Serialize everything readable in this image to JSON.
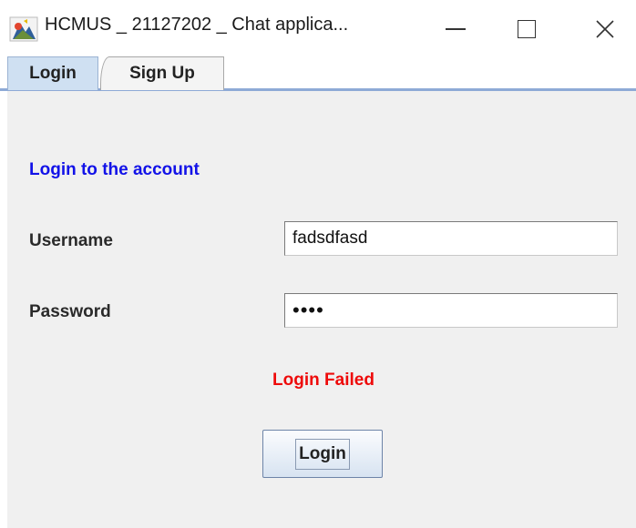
{
  "window": {
    "title": "HCMUS _ 21127202 _ Chat applica...",
    "icon": "java-app-icon",
    "controls": {
      "minimize_icon": "minimize-icon",
      "maximize_icon": "maximize-icon",
      "close_glyph": "✕"
    }
  },
  "tabs": [
    {
      "label": "Login",
      "selected": true
    },
    {
      "label": "Sign Up",
      "selected": false
    }
  ],
  "login_form": {
    "heading": "Login to the account",
    "username_label": "Username",
    "username_value": "fadsdfasd",
    "password_label": "Password",
    "password_masked": "••••",
    "status": "Login Failed",
    "submit_label": "Login"
  },
  "colors": {
    "heading": "#1212e8",
    "status_error": "#ee0a0a",
    "selected_tab": "#cfe0f2",
    "panel_bg": "#f0f0f0"
  }
}
